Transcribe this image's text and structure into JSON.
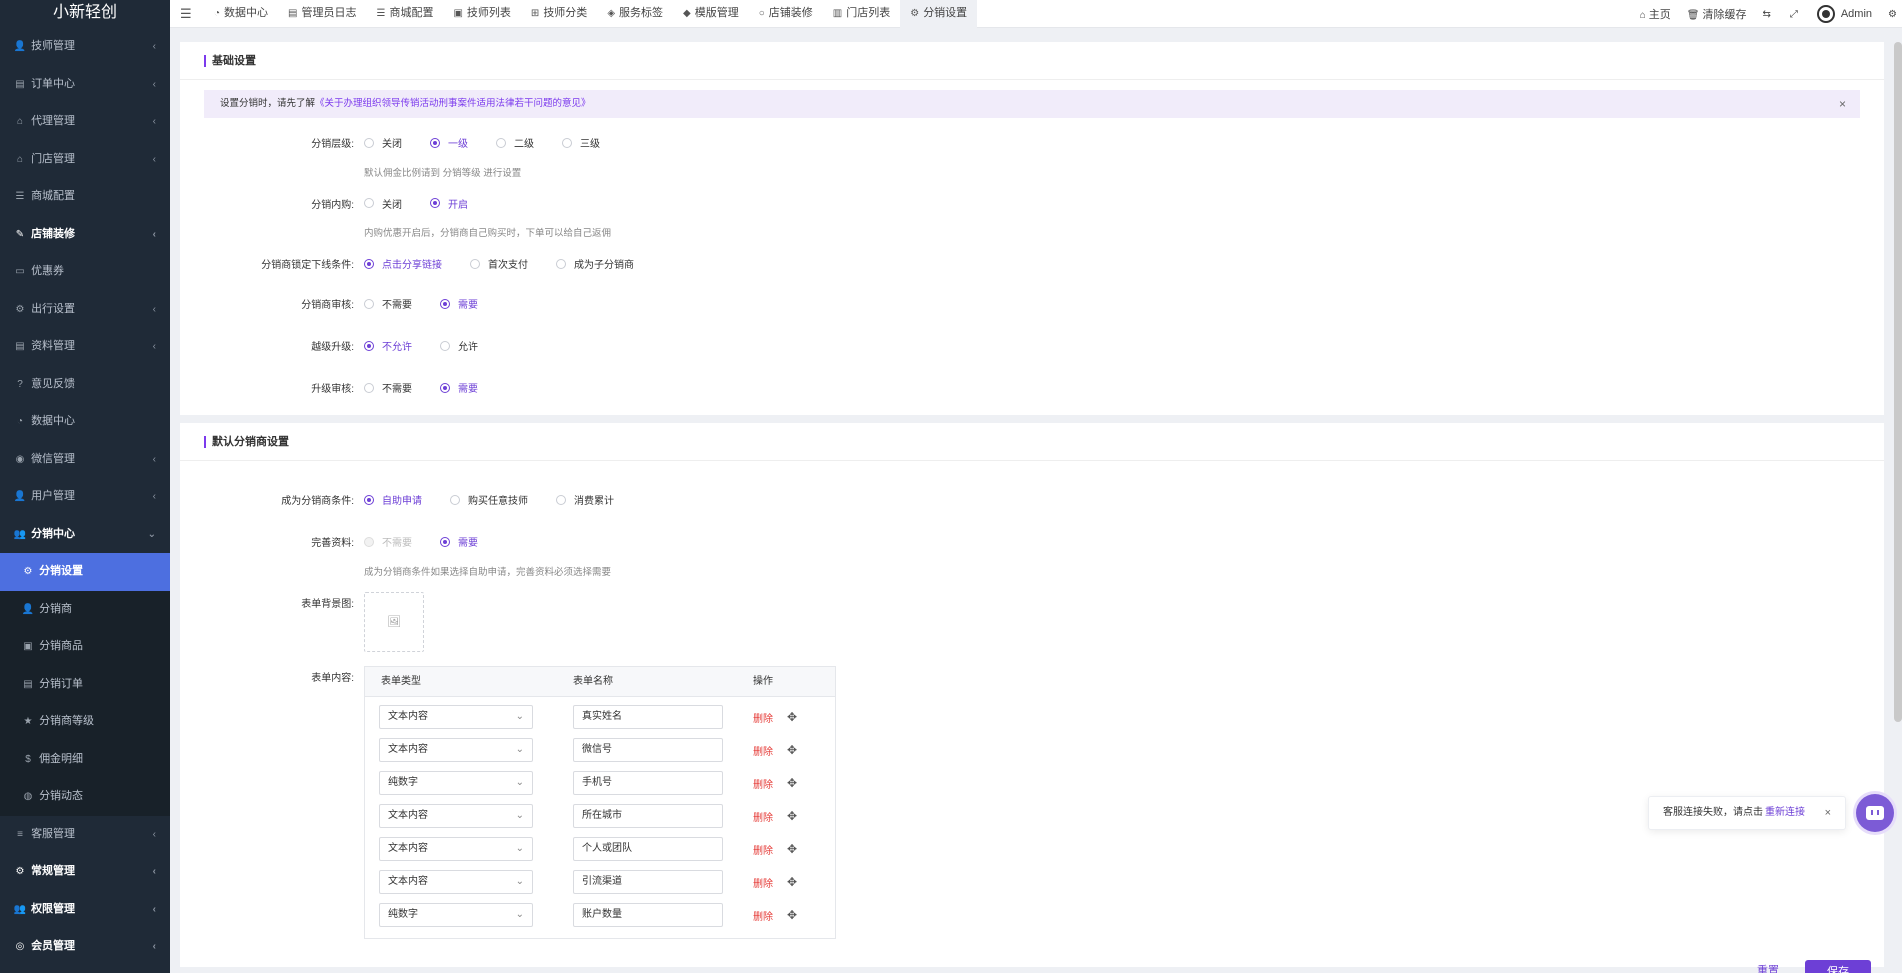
{
  "brand": "小新轻创",
  "sidebar": {
    "items": [
      {
        "label": "技师管理",
        "icon": "user-icon",
        "arrow": true,
        "bold": false
      },
      {
        "label": "订单中心",
        "icon": "file-icon",
        "arrow": true,
        "bold": false
      },
      {
        "label": "代理管理",
        "icon": "bank-icon",
        "arrow": true,
        "bold": false
      },
      {
        "label": "门店管理",
        "icon": "bank-icon",
        "arrow": true,
        "bold": false
      },
      {
        "label": "商城配置",
        "icon": "sliders-icon",
        "arrow": false,
        "bold": false
      },
      {
        "label": "店铺装修",
        "icon": "brush-icon",
        "arrow": true,
        "bold": true
      },
      {
        "label": "优惠券",
        "icon": "ticket-icon",
        "arrow": false,
        "bold": false
      },
      {
        "label": "出行设置",
        "icon": "gears-icon",
        "arrow": true,
        "bold": false
      },
      {
        "label": "资料管理",
        "icon": "file-icon",
        "arrow": true,
        "bold": false
      },
      {
        "label": "意见反馈",
        "icon": "question-icon",
        "arrow": false,
        "bold": false
      },
      {
        "label": "数据中心",
        "icon": "dashboard-icon",
        "arrow": false,
        "bold": false
      },
      {
        "label": "微信管理",
        "icon": "wechat-icon",
        "arrow": true,
        "bold": false
      },
      {
        "label": "用户管理",
        "icon": "user-icon",
        "arrow": true,
        "bold": false
      }
    ],
    "open_group": {
      "label": "分销中心",
      "icon": "users-icon"
    },
    "sub_items": [
      {
        "label": "分销设置",
        "icon": "gear-icon",
        "active": true
      },
      {
        "label": "分销商",
        "icon": "user-icon",
        "active": false
      },
      {
        "label": "分销商品",
        "icon": "briefcase-icon",
        "active": false
      },
      {
        "label": "分销订单",
        "icon": "file-icon",
        "active": false
      },
      {
        "label": "分销商等级",
        "icon": "star-icon",
        "active": false
      },
      {
        "label": "佣金明细",
        "icon": "dollar-icon",
        "active": false
      },
      {
        "label": "分销动态",
        "icon": "comments-icon",
        "active": false
      }
    ],
    "bottom_items": [
      {
        "label": "客服管理",
        "icon": "list-icon",
        "bold": false
      },
      {
        "label": "常规管理",
        "icon": "gears-icon",
        "bold": true
      },
      {
        "label": "权限管理",
        "icon": "users-icon",
        "bold": true
      },
      {
        "label": "会员管理",
        "icon": "user-circle-icon",
        "bold": true
      }
    ]
  },
  "topbar": {
    "tabs": [
      {
        "label": "数据中心",
        "icon": "dashboard-icon"
      },
      {
        "label": "管理员日志",
        "icon": "list-alt-icon"
      },
      {
        "label": "商城配置",
        "icon": "sliders-icon"
      },
      {
        "label": "技师列表",
        "icon": "briefcase-icon"
      },
      {
        "label": "技师分类",
        "icon": "sitemap-icon"
      },
      {
        "label": "服务标签",
        "icon": "tags-icon"
      },
      {
        "label": "模版管理",
        "icon": "cubes-icon"
      },
      {
        "label": "店铺装修",
        "icon": "circle-icon"
      },
      {
        "label": "门店列表",
        "icon": "building-icon"
      },
      {
        "label": "分销设置",
        "icon": "gear-icon",
        "active": true
      }
    ],
    "home": "主页",
    "clear_cache": "清除缓存",
    "user": "Admin"
  },
  "basic": {
    "title": "基础设置",
    "notice_prefix": "设置分销时，请先了解",
    "notice_link": "《关于办理组织领导传销活动刑事案件适用法律若干问题的意见》",
    "level": {
      "label": "分销层级:",
      "options": [
        "关闭",
        "一级",
        "二级",
        "三级"
      ],
      "selected": 1,
      "hint": "默认佣金比例请到 分销等级 进行设置"
    },
    "inner_buy": {
      "label": "分销内购:",
      "options": [
        "关闭",
        "开启"
      ],
      "selected": 1,
      "hint": "内购优惠开启后，分销商自己购买时，下单可以给自己返佣"
    },
    "lock": {
      "label": "分销商锁定下线条件:",
      "options": [
        "点击分享链接",
        "首次支付",
        "成为子分销商"
      ],
      "selected": 0
    },
    "review": {
      "label": "分销商审核:",
      "options": [
        "不需要",
        "需要"
      ],
      "selected": 1
    },
    "skip_upgrade": {
      "label": "越级升级:",
      "options": [
        "不允许",
        "允许"
      ],
      "selected": 0
    },
    "upgrade_review": {
      "label": "升级审核:",
      "options": [
        "不需要",
        "需要"
      ],
      "selected": 1
    }
  },
  "default": {
    "title": "默认分销商设置",
    "condition": {
      "label": "成为分销商条件:",
      "options": [
        "自助申请",
        "购买任意技师",
        "消费累计"
      ],
      "selected": 0
    },
    "complete": {
      "label": "完善资料:",
      "options": [
        "不需要",
        "需要"
      ],
      "selected": 1,
      "disabled": 0,
      "hint": "成为分销商条件如果选择自助申请，完善资料必须选择需要"
    },
    "bg_label": "表单背景图:",
    "form_label": "表单内容:",
    "table": {
      "headers": [
        "表单类型",
        "表单名称",
        "操作"
      ],
      "delete_label": "删除",
      "rows": [
        {
          "type": "文本内容",
          "name": "真实姓名"
        },
        {
          "type": "文本内容",
          "name": "微信号"
        },
        {
          "type": "纯数字",
          "name": "手机号"
        },
        {
          "type": "文本内容",
          "name": "所在城市"
        },
        {
          "type": "文本内容",
          "name": "个人或团队"
        },
        {
          "type": "文本内容",
          "name": "引流渠道"
        },
        {
          "type": "纯数字",
          "name": "账户数量"
        }
      ]
    }
  },
  "toast": {
    "text": "客服连接失败，请点击",
    "link": "重新连接"
  },
  "buttons": {
    "reset": "重置",
    "save": "保存"
  }
}
